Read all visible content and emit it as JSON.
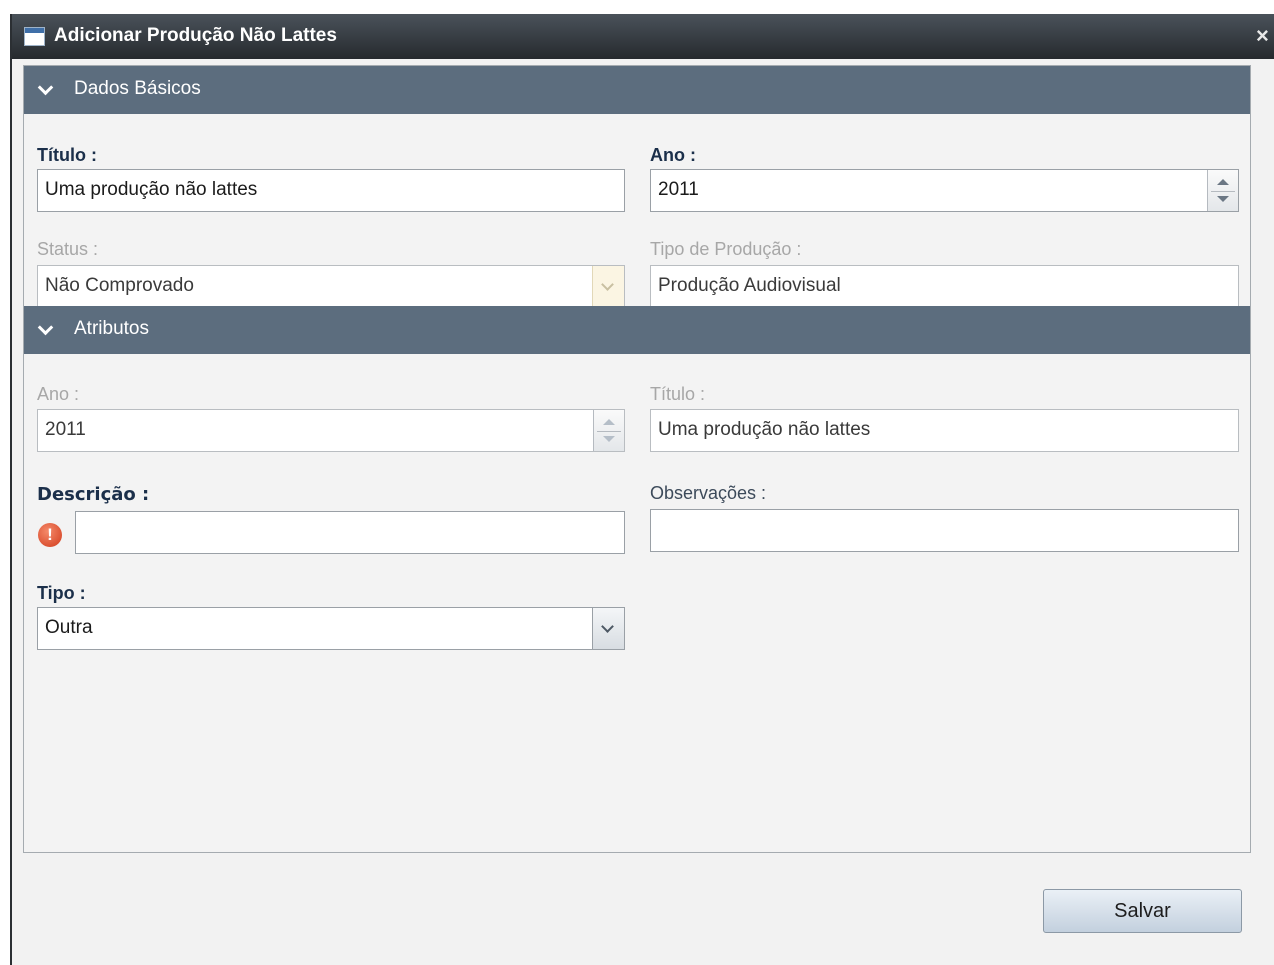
{
  "window": {
    "title": "Adicionar Produção Não Lattes",
    "close": "×"
  },
  "dados_basicos": {
    "header": "Dados Básicos",
    "titulo_label": "Título :",
    "titulo_value": "Uma produção não lattes",
    "ano_label": "Ano :",
    "ano_value": "2011",
    "status_label": "Status :",
    "status_value": "Não Comprovado",
    "tipo_producao_label": "Tipo de Produção :",
    "tipo_producao_value": "Produção Audiovisual"
  },
  "atributos": {
    "header": "Atributos",
    "ano_label": "Ano :",
    "ano_value": "2011",
    "titulo_label": "Título :",
    "titulo_value": "Uma produção não lattes",
    "descricao_label": "Descrição :",
    "descricao_value": "",
    "observacoes_label": "Observações :",
    "observacoes_value": "",
    "tipo_label": "Tipo :",
    "tipo_value": "Outra",
    "error_icon_glyph": "!"
  },
  "footer": {
    "save_label": "Salvar"
  }
}
